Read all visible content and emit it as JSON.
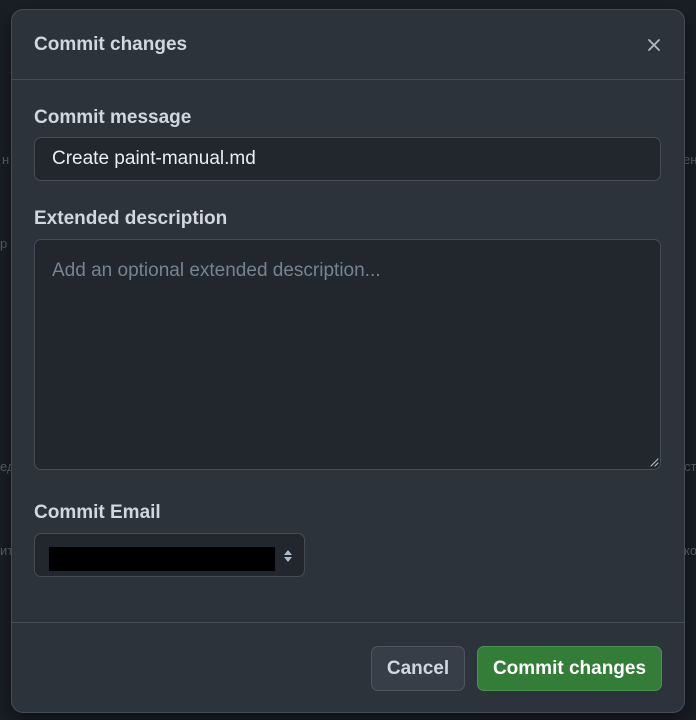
{
  "dialog": {
    "title": "Commit changes",
    "close_icon": "x-icon"
  },
  "form": {
    "message_label": "Commit message",
    "message_value": "Create paint-manual.md",
    "description_label": "Extended description",
    "description_placeholder": "Add an optional extended description...",
    "email_label": "Commit Email",
    "email_select_icon": "sort-arrows-icon"
  },
  "footer": {
    "cancel_label": "Cancel",
    "commit_label": "Commit changes"
  },
  "background_fragments": [
    "н",
    "ен",
    "р",
    "ед",
    "ст",
    "ит",
    "ко"
  ],
  "colors": {
    "dialog_bg": "#2d333b",
    "input_bg": "#22272e",
    "border": "#444c56",
    "primary_button": "#347d39",
    "text": "#d1d7e0",
    "placeholder": "#768390"
  }
}
